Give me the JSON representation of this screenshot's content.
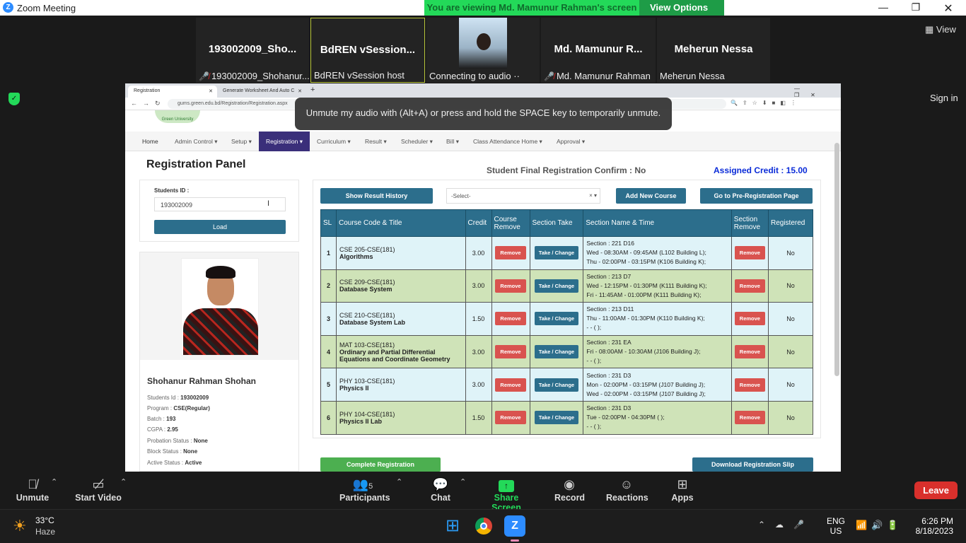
{
  "zoom": {
    "title": "Zoom Meeting",
    "banner": "You are viewing Md. Mamunur Rahman's screen",
    "view_options": "View Options",
    "view": "View",
    "sign_in": "Sign in",
    "leave": "Leave"
  },
  "participants": [
    {
      "name": "193002009_Sho...",
      "label": "193002009_Shohanur...",
      "muted": true
    },
    {
      "name": "BdREN  vSession...",
      "label": "BdREN vSession host",
      "muted": false
    },
    {
      "name": "",
      "label": "Connecting to audio ··",
      "muted": false
    },
    {
      "name": "Md.  Mamunur  R...",
      "label": "Md. Mamunur Rahman",
      "muted": true
    },
    {
      "name": "Meherun Nessa",
      "label": "Meherun Nessa",
      "muted": false
    }
  ],
  "browser": {
    "tabs": [
      "Registration",
      "Generate Worksheet And Auto C"
    ],
    "url": "gums.green.edu.bd/Registration/Registration.aspx",
    "tooltip": "Unmute my audio with (Alt+A) or press and hold the SPACE key to temporarily unmute.",
    "logo_text": "Green University"
  },
  "nav": [
    "Home",
    "Admin Control ▾",
    "Setup ▾",
    "Registration ▾",
    "Curriculum ▾",
    "Result ▾",
    "Scheduler ▾",
    "Bill ▾",
    "Class Attendance Home ▾",
    "Approval ▾"
  ],
  "panel": {
    "title": "Registration Panel",
    "confirm": "Student Final Registration Confirm : No",
    "credit": "Assigned Credit : 15.00",
    "students_id_label": "Students ID :",
    "students_id_value": "193002009",
    "load": "Load"
  },
  "student": {
    "name": "Shohanur Rahman Shohan",
    "info": [
      {
        "k": "Students Id : ",
        "v": "193002009"
      },
      {
        "k": "Program : ",
        "v": "CSE(Regular)"
      },
      {
        "k": "Batch : ",
        "v": "193"
      },
      {
        "k": "CGPA : ",
        "v": "2.95"
      },
      {
        "k": "Probation Status : ",
        "v": "None"
      },
      {
        "k": "Block Status : ",
        "v": "None"
      },
      {
        "k": "Active Status : ",
        "v": "Active"
      }
    ]
  },
  "actions": {
    "show_result": "Show Result History",
    "select": "-Select-",
    "add_course": "Add New Course",
    "pre_reg": "Go to Pre-Registration Page",
    "complete": "Complete Registration",
    "download": "Download Registration Slip"
  },
  "table": {
    "headers": [
      "SL",
      "Course Code & Title",
      "Credit",
      "Course Remove",
      "Section Take",
      "Section Name & Time",
      "Section Remove",
      "Registered"
    ],
    "remove": "Remove",
    "take": "Take / Change",
    "rows": [
      {
        "sl": "1",
        "code": "CSE 205-CSE(181)",
        "title": "Algorithms",
        "credit": "3.00",
        "sec": "Section : 221 D16",
        "t1": "Wed - 08:30AM - 09:45AM (L102 Building L);",
        "t2": "Thu - 02:00PM - 03:15PM (K106 Building K);",
        "reg": "No"
      },
      {
        "sl": "2",
        "code": "CSE 209-CSE(181)",
        "title": "Database System",
        "credit": "3.00",
        "sec": "Section : 213 D7",
        "t1": "Wed - 12:15PM - 01:30PM (K111 Building K);",
        "t2": "Fri - 11:45AM - 01:00PM (K111 Building K);",
        "reg": "No"
      },
      {
        "sl": "3",
        "code": "CSE 210-CSE(181)",
        "title": "Database System Lab",
        "credit": "1.50",
        "sec": "Section : 213 D11",
        "t1": "Thu - 11:00AM - 01:30PM (K110 Building K);",
        "t2": "- - ( );",
        "reg": "No"
      },
      {
        "sl": "4",
        "code": "MAT 103-CSE(181)",
        "title": "Ordinary and Partial Differential Equations and Coordinate Geometry",
        "credit": "3.00",
        "sec": "Section : 231 EA",
        "t1": "Fri - 08:00AM - 10:30AM (J106 Building J);",
        "t2": "- - ( );",
        "reg": "No"
      },
      {
        "sl": "5",
        "code": "PHY 103-CSE(181)",
        "title": "Physics II",
        "credit": "3.00",
        "sec": "Section : 231 D3",
        "t1": "Mon - 02:00PM - 03:15PM (J107 Building J);",
        "t2": "Wed - 02:00PM - 03:15PM (J107 Building J);",
        "reg": "No"
      },
      {
        "sl": "6",
        "code": "PHY 104-CSE(181)",
        "title": "Physics II Lab",
        "credit": "1.50",
        "sec": "Section : 231 D3",
        "t1": "Tue - 02:00PM - 04:30PM ( );",
        "t2": "- - ( );",
        "reg": "No"
      }
    ]
  },
  "toolbar": {
    "unmute": "Unmute",
    "start_video": "Start Video",
    "participants": "Participants",
    "participants_count": "5",
    "chat": "Chat",
    "share": "Share Screen",
    "record": "Record",
    "reactions": "Reactions",
    "apps": "Apps"
  },
  "taskbar": {
    "temp": "33°C",
    "weather": "Haze",
    "lang1": "ENG",
    "lang2": "US",
    "time": "6:26 PM",
    "date": "8/18/2023"
  }
}
